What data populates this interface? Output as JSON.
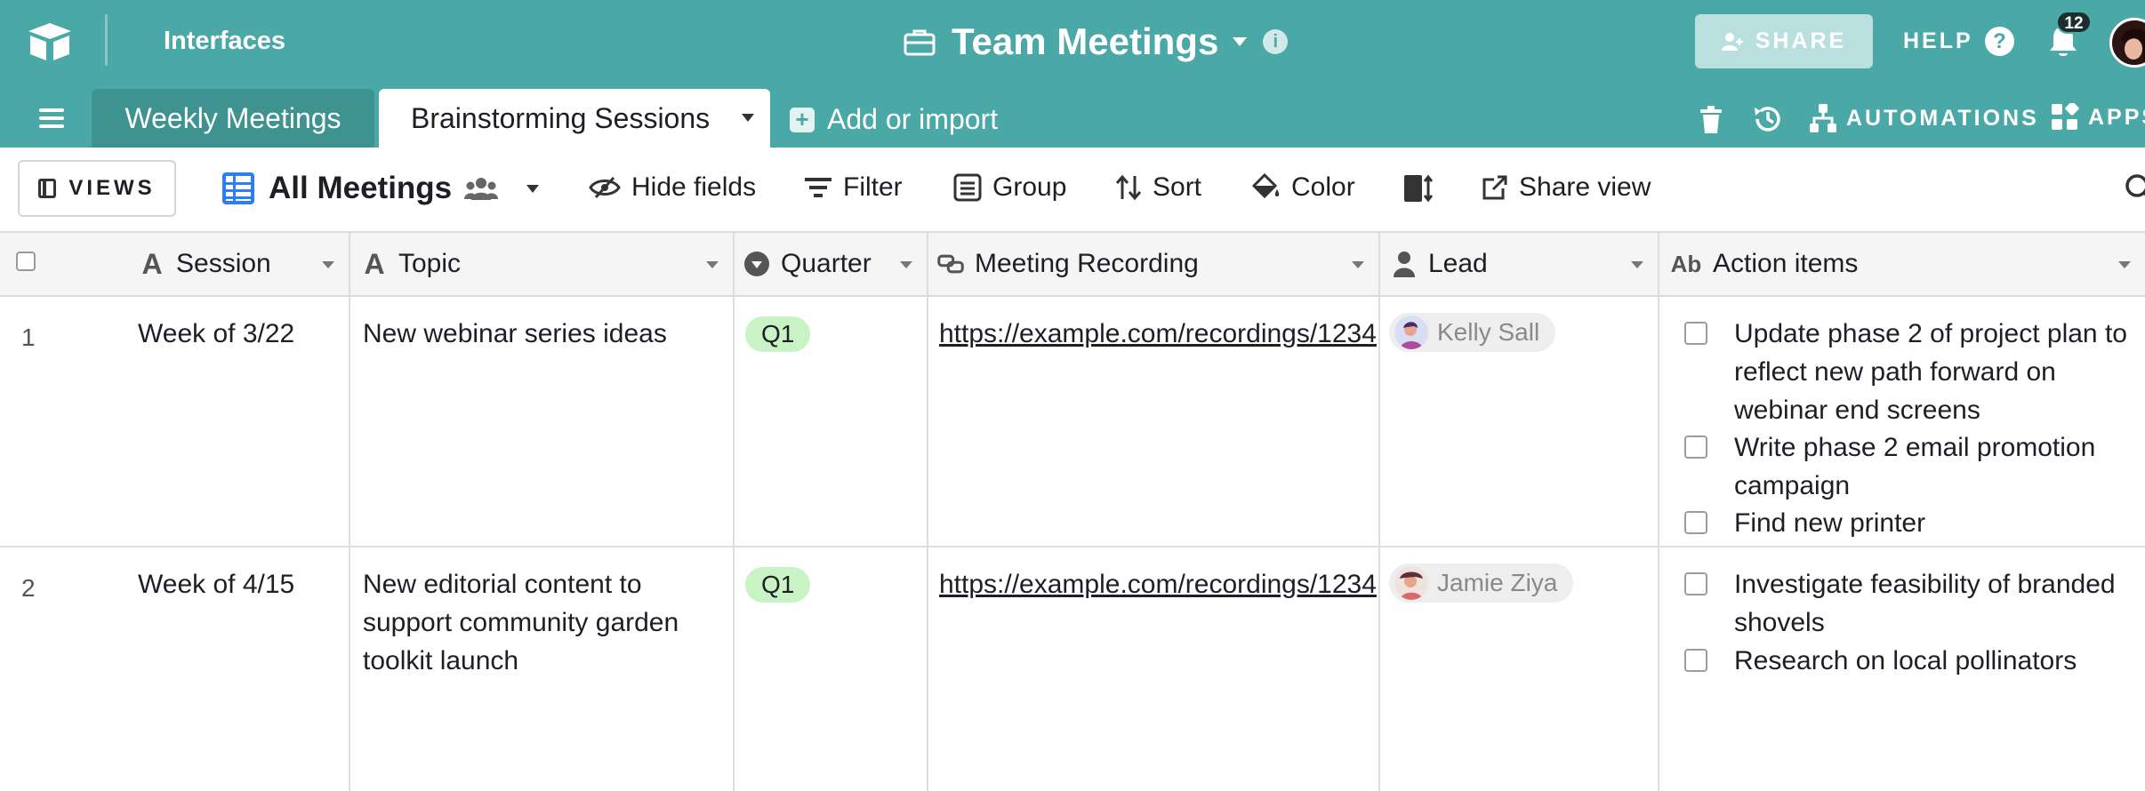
{
  "app": {
    "interfaces_label": "Interfaces",
    "base_title": "Team Meetings",
    "share_label": "SHARE",
    "help_label": "HELP",
    "notification_count": "12",
    "accent_color": "#4aa8a6"
  },
  "tables": {
    "tabs": [
      {
        "label": "Weekly Meetings",
        "active": false
      },
      {
        "label": "Brainstorming Sessions",
        "active": true
      }
    ],
    "add_import_label": "Add or import",
    "automations_label": "AUTOMATIONS",
    "apps_label": "APPS"
  },
  "viewbar": {
    "views_label": "VIEWS",
    "view_name": "All Meetings",
    "hide_fields_label": "Hide fields",
    "filter_label": "Filter",
    "group_label": "Group",
    "sort_label": "Sort",
    "color_label": "Color",
    "share_view_label": "Share view"
  },
  "grid": {
    "columns": [
      {
        "label": "Session",
        "type_icon": "text-icon"
      },
      {
        "label": "Topic",
        "type_icon": "text-icon"
      },
      {
        "label": "Quarter",
        "type_icon": "single-select-icon"
      },
      {
        "label": "Meeting Recording",
        "type_icon": "url-icon"
      },
      {
        "label": "Lead",
        "type_icon": "user-icon"
      },
      {
        "label": "Action items",
        "type_icon": "rich-text-icon"
      }
    ],
    "rows": [
      {
        "number": "1",
        "session": "Week of 3/22",
        "topic": "New webinar series ideas",
        "quarter": "Q1",
        "recording": "https://example.com/recordings/1234",
        "lead": "Kelly Sall",
        "actions": [
          "Update phase 2 of project plan to reflect new path forward on webinar end screens",
          "Write phase 2 email promotion campaign",
          "Find new printer"
        ]
      },
      {
        "number": "2",
        "session": "Week of 4/15",
        "topic": "New editorial content to support community garden toolkit launch",
        "quarter": "Q1",
        "recording": "https://example.com/recordings/1234",
        "lead": "Jamie Ziya",
        "actions": [
          "Investigate feasibility of branded shovels",
          "Research on local pollinators"
        ]
      }
    ]
  }
}
